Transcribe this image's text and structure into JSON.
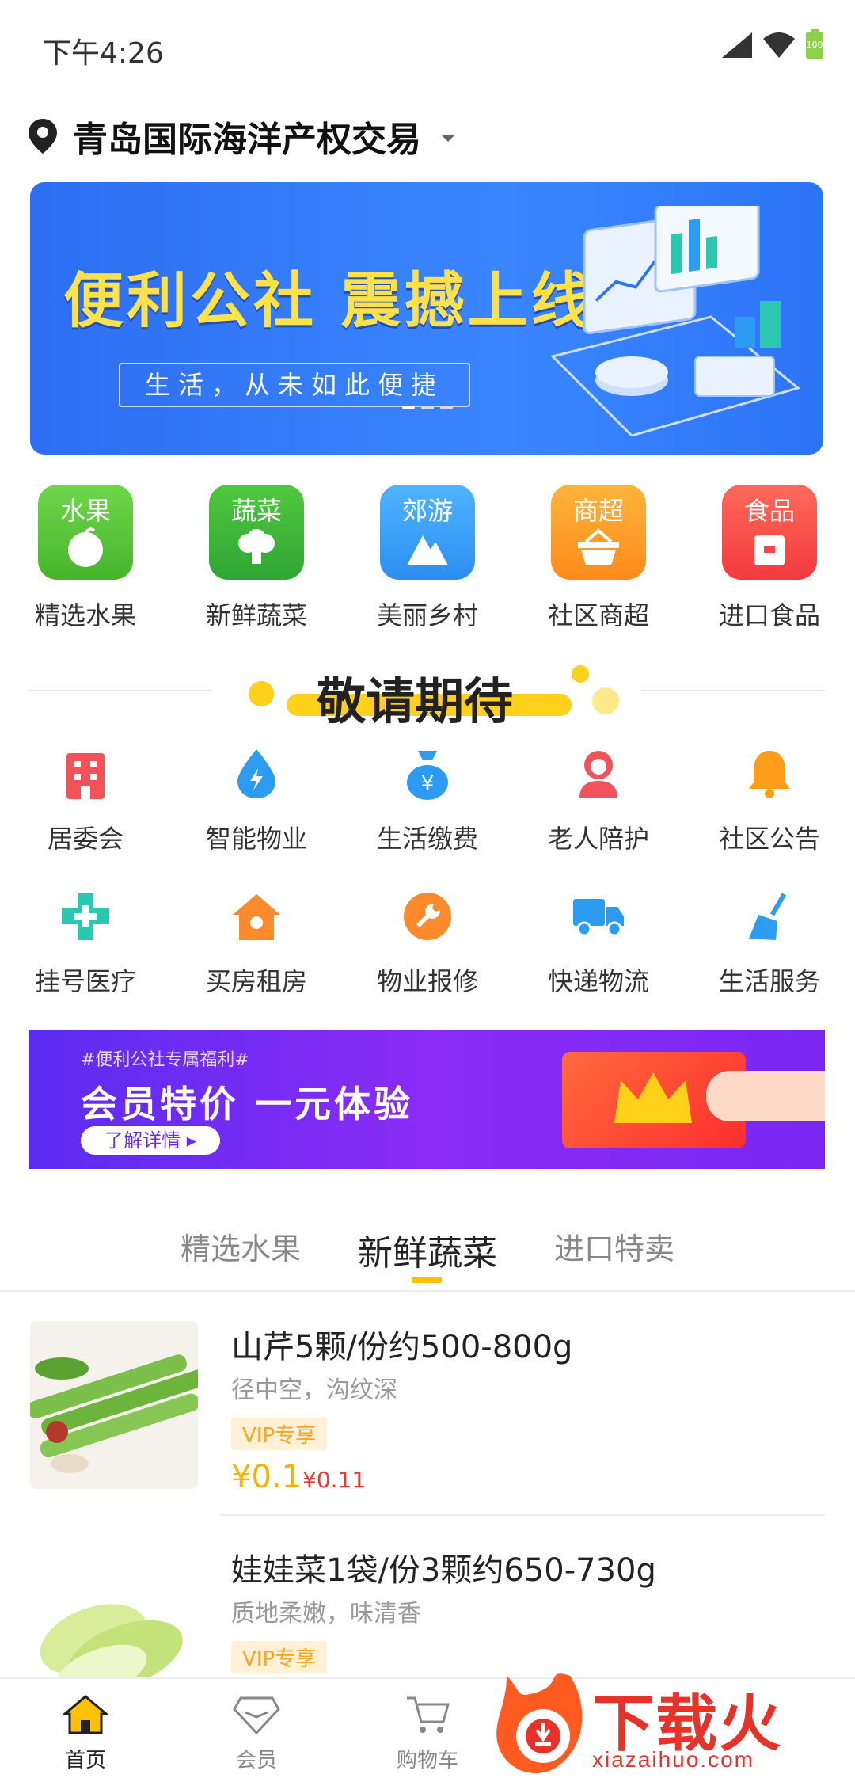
{
  "status": {
    "time": "下午4:26",
    "battery": "100"
  },
  "location": {
    "title": "青岛国际海洋产权交易"
  },
  "banner": {
    "title": "便利公社  震撼上线",
    "subtitle": "生活，从未如此便捷"
  },
  "categories": [
    {
      "tag": "水果",
      "label": "精选水果",
      "color": "#5cc73a",
      "icon": "apple-icon"
    },
    {
      "tag": "蔬菜",
      "label": "新鲜蔬菜",
      "color": "#34b13a",
      "icon": "broccoli-icon"
    },
    {
      "tag": "郊游",
      "label": "美丽乡村",
      "color": "#2f9ef2",
      "icon": "mountain-icon"
    },
    {
      "tag": "商超",
      "label": "社区商超",
      "color": "#ff9e1b",
      "icon": "basket-icon"
    },
    {
      "tag": "食品",
      "label": "进口食品",
      "color": "#f2474a",
      "icon": "package-icon"
    }
  ],
  "coming_soon": {
    "title": "敬请期待"
  },
  "services_row1": [
    {
      "label": "居委会",
      "icon": "building-icon",
      "color": "#f2525a"
    },
    {
      "label": "智能物业",
      "icon": "water-drop-icon",
      "color": "#2c9cf2"
    },
    {
      "label": "生活缴费",
      "icon": "money-bag-icon",
      "color": "#2c9cf2"
    },
    {
      "label": "老人陪护",
      "icon": "person-icon",
      "color": "#f2525a"
    },
    {
      "label": "社区公告",
      "icon": "bell-icon",
      "color": "#ff9e1b"
    }
  ],
  "services_row2": [
    {
      "label": "挂号医疗",
      "icon": "medical-cross-icon",
      "color": "#2cc7b0"
    },
    {
      "label": "买房租房",
      "icon": "house-icon",
      "color": "#ff8a2b"
    },
    {
      "label": "物业报修",
      "icon": "wrench-icon",
      "color": "#ff8a2b"
    },
    {
      "label": "快递物流",
      "icon": "truck-icon",
      "color": "#2c9cf2"
    },
    {
      "label": "生活服务",
      "icon": "broom-icon",
      "color": "#2c9cf2"
    }
  ],
  "promo": {
    "tag": "#便利公社专属福利#",
    "title": "会员特价  一元体验",
    "button": "了解详情"
  },
  "tabs": [
    "精选水果",
    "新鲜蔬菜",
    "进口特卖"
  ],
  "products": [
    {
      "name": "山芹5颗/份约500-800g",
      "desc": "径中空，沟纹深",
      "vip": "VIP专享",
      "price": "¥0.1",
      "orig": "¥0.11"
    },
    {
      "name": "娃娃菜1袋/份3颗约650-730g",
      "desc": "质地柔嫩，味清香",
      "vip": "VIP专享"
    }
  ],
  "bottom_nav": [
    {
      "label": "首页",
      "icon": "home-icon"
    },
    {
      "label": "会员",
      "icon": "diamond-icon"
    },
    {
      "label": "购物车",
      "icon": "cart-icon"
    },
    {
      "label": "",
      "icon": ""
    },
    {
      "label": "",
      "icon": ""
    }
  ],
  "watermark": {
    "text": "下载火",
    "url": "xiazaihuo.com"
  },
  "colors": {
    "accent": "#ffc107",
    "price": "#f5b400",
    "orig_price": "#e53935"
  }
}
